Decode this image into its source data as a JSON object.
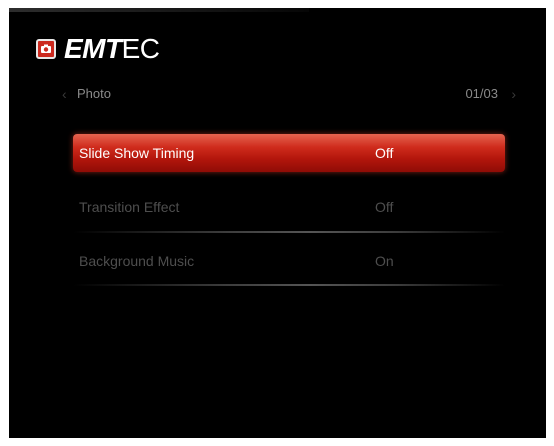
{
  "brand": {
    "logo_bold": "EMT",
    "logo_rest": "EC"
  },
  "nav": {
    "category": "Photo",
    "page_indicator": "01/03"
  },
  "settings": [
    {
      "label": "Slide Show Timing",
      "value": "Off"
    },
    {
      "label": "Transition Effect",
      "value": "Off"
    },
    {
      "label": "Background Music",
      "value": "On"
    }
  ],
  "colors": {
    "background": "#000000",
    "highlight": "#cf2b1c",
    "dim_text": "#4e4e4e"
  },
  "icons": {
    "logo": "camera-icon",
    "prev": "chevron-left-icon",
    "next": "chevron-right-icon"
  }
}
